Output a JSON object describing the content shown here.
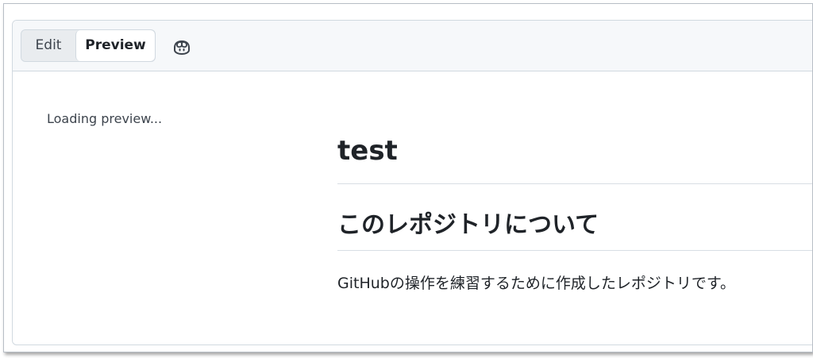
{
  "tabs": {
    "edit_label": "Edit",
    "preview_label": "Preview",
    "active": "Preview"
  },
  "toolbar": {
    "copilot_icon": "copilot-icon"
  },
  "preview": {
    "loading_text": "Loading preview...",
    "heading1": "test",
    "heading2": "このレポジトリについて",
    "paragraph": "GitHubの操作を練習するために作成したレポジトリです。"
  },
  "colors": {
    "header_bg": "#f6f8fa",
    "border": "#d1d9e0",
    "text": "#1f2328",
    "muted_text": "#3d444d"
  }
}
